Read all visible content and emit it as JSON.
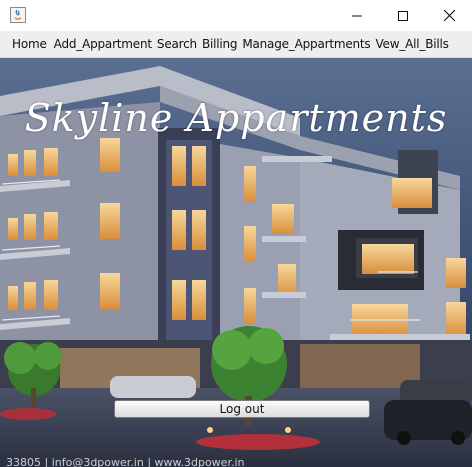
{
  "window": {
    "title": "",
    "icon": "java-app-icon",
    "controls": [
      "minimize-icon",
      "maximize-icon",
      "close-icon"
    ]
  },
  "menu": {
    "items": [
      {
        "label": "Home"
      },
      {
        "label": "Add_Appartment"
      },
      {
        "label": "Search"
      },
      {
        "label": "Billing"
      },
      {
        "label": "Manage_Appartments"
      },
      {
        "label": "Vew_All_Bills"
      }
    ]
  },
  "banner": {
    "headline": "Skyline Appartments",
    "watermark": "33805 | info@3dpower.in | www.3dpower.in"
  },
  "actions": {
    "logout_label": "Log out"
  },
  "colors": {
    "sky_top": "#55698a",
    "sky_bottom": "#2c3a57",
    "facade": "#8d93a5",
    "warm_light": "#f2c27a",
    "dark_panel": "#2a2c35"
  }
}
